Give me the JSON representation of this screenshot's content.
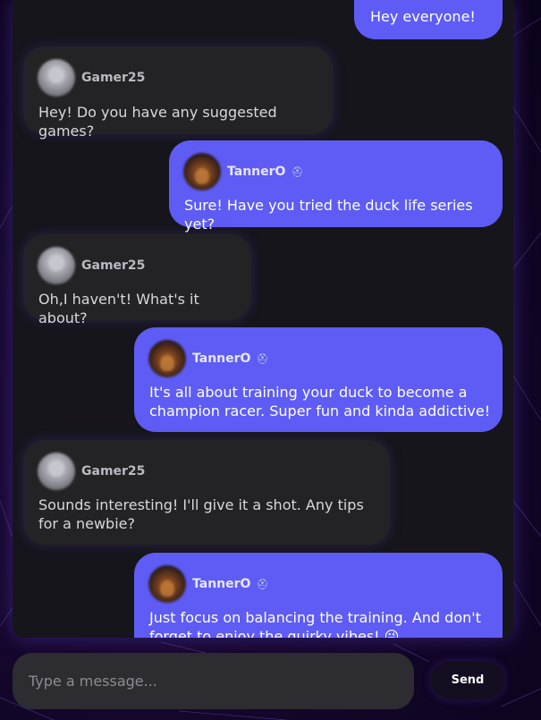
{
  "messages": [
    {
      "sender": "",
      "text": "Hey everyone!",
      "outgoing": true
    },
    {
      "sender": "Gamer25",
      "text": "Hey! Do you have any suggested games?",
      "outgoing": false
    },
    {
      "sender": "TannerO",
      "text": "Sure! Have you tried the duck life series yet?",
      "outgoing": true
    },
    {
      "sender": "Gamer25",
      "text": "Oh,I haven't! What's it about?",
      "outgoing": false
    },
    {
      "sender": "TannerO",
      "text": "It's all about training your duck to become a champion racer. Super fun and kinda addictive!",
      "outgoing": true
    },
    {
      "sender": "Gamer25",
      "text": "Sounds interesting! I'll give it a shot. Any tips for a newbie?",
      "outgoing": false
    },
    {
      "sender": "TannerO",
      "text": "Just focus on balancing the training. And don't forget to enjoy the quirky vibes! 😜",
      "outgoing": true
    }
  ],
  "badges": {
    "self_badge_icon": "helmet-badge-icon"
  },
  "composer": {
    "placeholder": "Type a message...",
    "send_label": "Send"
  },
  "colors": {
    "self_bubble": "#5e5cf5",
    "other_bubble": "#232325",
    "panel": "#15151b",
    "accent_glow": "#7c4dff"
  }
}
